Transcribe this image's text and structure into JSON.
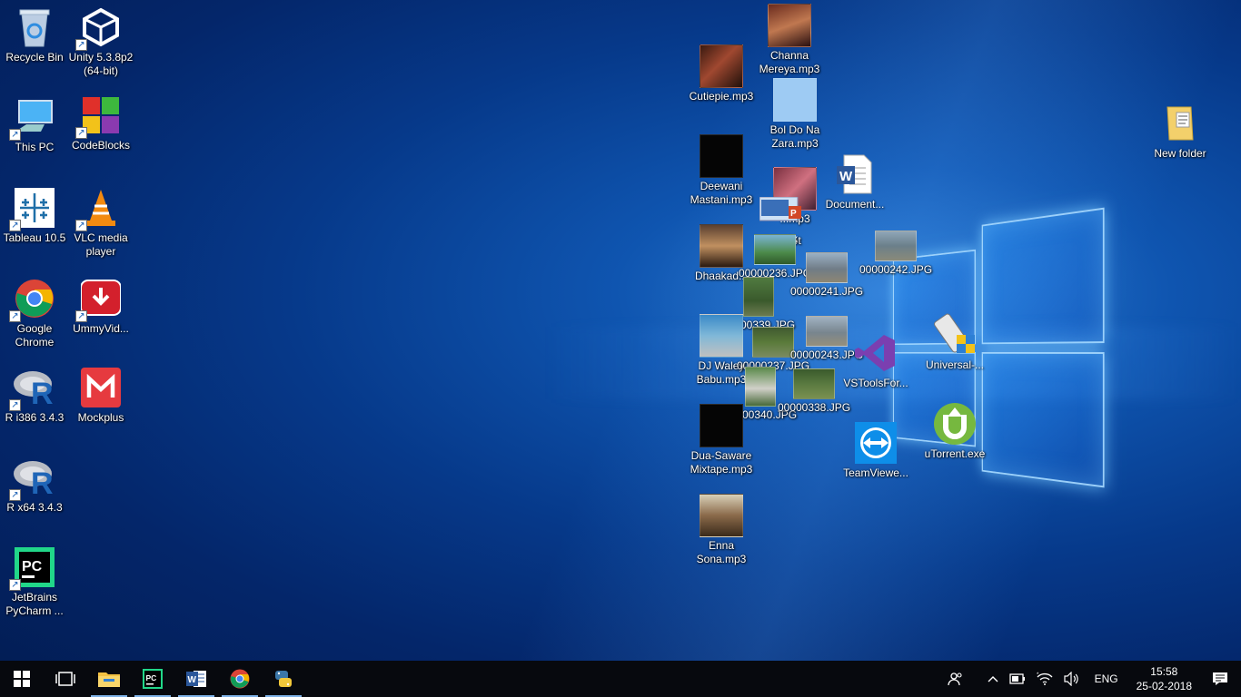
{
  "desktop": {
    "icons_left": [
      {
        "label": "Recycle Bin"
      },
      {
        "label": "Unity 5.3.8p2 (64-bit)"
      },
      {
        "label": "This PC"
      },
      {
        "label": "CodeBlocks"
      },
      {
        "label": "Tableau 10.5"
      },
      {
        "label": "VLC media player"
      },
      {
        "label": "Google Chrome"
      },
      {
        "label": "UmmyVid..."
      },
      {
        "label": "R i386 3.4.3"
      },
      {
        "label": "Mockplus"
      },
      {
        "label": "R x64 3.4.3"
      },
      {
        "label": "JetBrains PyCharm ..."
      }
    ],
    "files": [
      {
        "label": "Channa Mereya.mp3"
      },
      {
        "label": "Cutiepie.mp3"
      },
      {
        "label": "Bol Do Na Zara.mp3"
      },
      {
        "label": "Deewani Mastani.mp3"
      },
      {
        "label": "Document..."
      },
      {
        "label": "ChatBot"
      },
      {
        "label": "Dhaakad..."
      },
      {
        "label": "00000236.JPG"
      },
      {
        "label": "00000242.JPG"
      },
      {
        "label": "00000241.JPG"
      },
      {
        "label": "00000339.JPG"
      },
      {
        "label": "DJ Waley Babu.mp3"
      },
      {
        "label": "00000237.JPG"
      },
      {
        "label": "00000243.JPG"
      },
      {
        "label": "VSToolsFor..."
      },
      {
        "label": "Universal-..."
      },
      {
        "label": "00000340.JPG"
      },
      {
        "label": "00000338.JPG"
      },
      {
        "label": "Dua-Saware Mixtape.mp3"
      },
      {
        "label": "TeamViewe..."
      },
      {
        "label": "uTorrent.exe"
      },
      {
        "label": "Enna Sona.mp3"
      },
      {
        "label": "New folder"
      },
      {
        "label": "...mp3"
      },
      {
        "label": "ptx"
      }
    ]
  },
  "taskbar": {
    "apps": [
      "start-icon",
      "task-view-icon",
      "file-explorer-icon",
      "pycharm-icon",
      "word-icon",
      "chrome-icon",
      "python-icon"
    ],
    "tray": {
      "language": "ENG",
      "time": "15:58",
      "date": "25-02-2018"
    }
  },
  "colors": {
    "taskbar": "#07090e",
    "wallpaper_accent": "#2f7fd6"
  }
}
